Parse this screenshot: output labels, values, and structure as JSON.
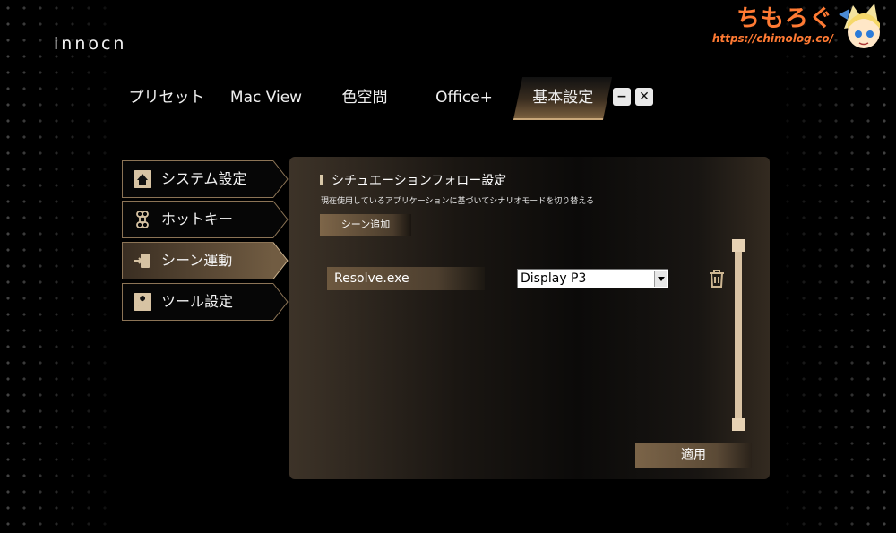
{
  "app": {
    "logo": "innocn"
  },
  "watermark": {
    "title": "ちもろぐ",
    "url": "https://chimolog.co/"
  },
  "tabs": [
    {
      "label": "プリセット"
    },
    {
      "label": "Mac View"
    },
    {
      "label": "色空間"
    },
    {
      "label": "Office+"
    },
    {
      "label": "基本設定",
      "active": true
    }
  ],
  "window_controls": {
    "minimize": "−",
    "close": "✕"
  },
  "sidebar": {
    "items": [
      {
        "label": "システム設定",
        "icon": "home-icon"
      },
      {
        "label": "ホットキー",
        "icon": "command-key-icon"
      },
      {
        "label": "シーン運動",
        "icon": "door-enter-icon",
        "active": true
      },
      {
        "label": "ツール設定",
        "icon": "wrench-icon"
      }
    ]
  },
  "panel": {
    "title": "シチュエーションフォロー設定",
    "description": "現在使用しているアプリケーションに基づいてシナリオモードを切り替える",
    "add_scene_label": "シーン追加",
    "rows": [
      {
        "app": "Resolve.exe",
        "mode": "Display P3",
        "delete_icon": "trash-icon"
      }
    ],
    "apply_label": "適用"
  },
  "colors": {
    "accent": "#c9a77a",
    "watermark": "#ff7a33"
  }
}
